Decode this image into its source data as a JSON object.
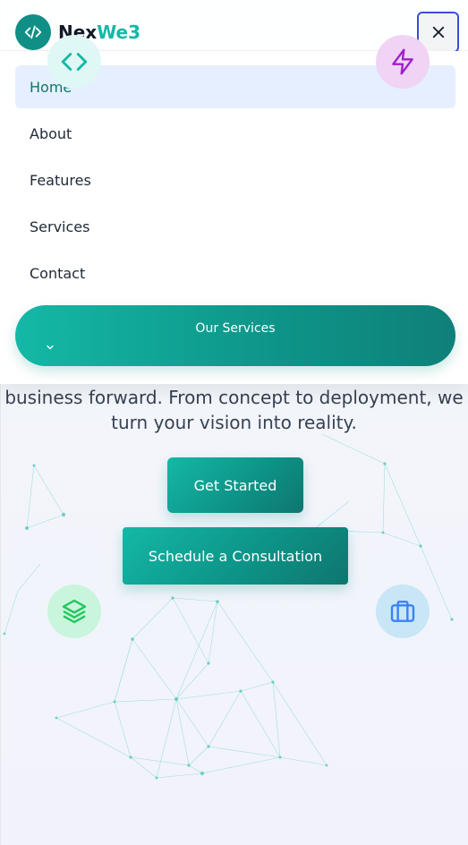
{
  "brand": {
    "name_part1": "Nex",
    "name_part2": "We3",
    "accent": "#14b8a6",
    "logo_icon": "code-brackets-icon"
  },
  "header": {
    "close_icon": "close-icon"
  },
  "menu": {
    "items": [
      {
        "label": "Home",
        "active": true
      },
      {
        "label": "About",
        "active": false
      },
      {
        "label": "Features",
        "active": false
      },
      {
        "label": "Services",
        "active": false
      },
      {
        "label": "Contact",
        "active": false
      }
    ],
    "services_button": {
      "label": "Our Services",
      "icon": "chevron-down-icon"
    }
  },
  "hero": {
    "description_line1": "business forward. From concept to deployment, we",
    "description_line2": "turn your vision into reality.",
    "primary_cta": "Get Started",
    "secondary_cta": "Schedule a Consultation"
  },
  "floating_icons": [
    "code-icon",
    "bolt-icon",
    "layers-icon",
    "briefcase-icon"
  ],
  "colors": {
    "teal": "#0d9488",
    "active_menu_bg": "#e5efff",
    "close_border": "#3b4ed8"
  }
}
